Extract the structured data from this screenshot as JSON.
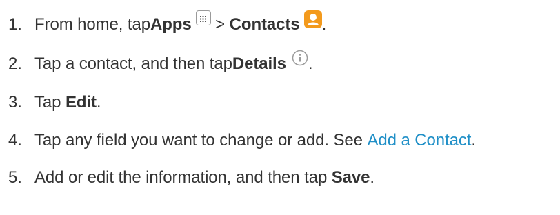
{
  "steps": [
    {
      "number": "1.",
      "text_before": "From home, tap ",
      "bold1": "Apps",
      "separator": " > ",
      "bold2": "Contacts",
      "end": "."
    },
    {
      "number": "2.",
      "text_before": "Tap a contact, and then tap ",
      "bold1": "Details",
      "end": "."
    },
    {
      "number": "3.",
      "text_before": "Tap ",
      "bold1": "Edit",
      "end": "."
    },
    {
      "number": "4.",
      "text_before": "Tap any field you want to change or add. See ",
      "link": "Add a Contact",
      "end": "."
    },
    {
      "number": "5.",
      "text_before": "Add or edit the information, and then tap ",
      "bold1": "Save",
      "end": "."
    }
  ],
  "icons": {
    "apps": "apps-grid-icon",
    "contacts": "contacts-icon",
    "details": "info-icon"
  },
  "colors": {
    "text": "#333333",
    "link": "#1f8fc7",
    "contacts_icon": "#f39a1d"
  }
}
